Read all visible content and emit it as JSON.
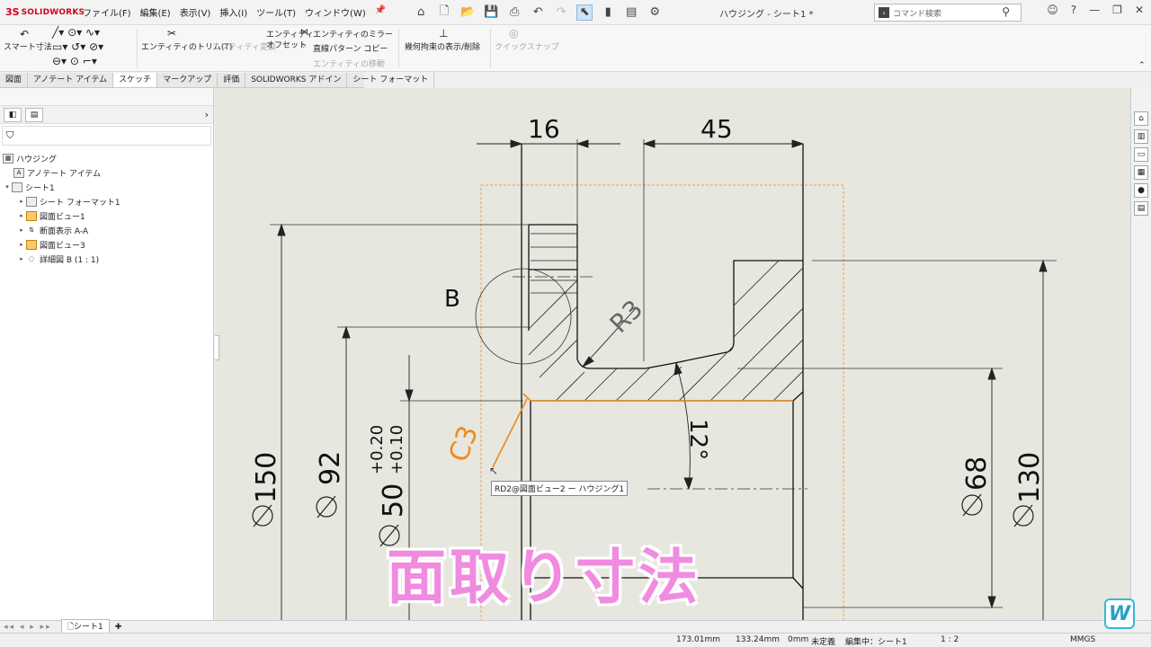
{
  "app": {
    "logo_brand": "SOLIDWORKS",
    "window_title": "ハウジング - シート1 *"
  },
  "menu": [
    "ファイル(F)",
    "編集(E)",
    "表示(V)",
    "挿入(I)",
    "ツール(T)",
    "ウィンドウ(W)"
  ],
  "search": {
    "placeholder": "コマンド検索"
  },
  "ribbon": {
    "smart_dim": "スマート寸法",
    "trim": "エンティティのトリム(T)",
    "convert": "エンティティ変換",
    "offset_line1": "エンティティ",
    "offset_line2": "オフセット",
    "mirror": "エンティティのミラー",
    "linear_pattern": "直線パターン コピー",
    "move": "エンティティの移動",
    "relations": "幾何拘束の表示/削除",
    "quick_snap": "クイックスナップ"
  },
  "tabs": [
    "図面",
    "アノテート アイテム",
    "スケッチ",
    "マークアップ",
    "評価",
    "SOLIDWORKS アドイン",
    "シート フォーマット"
  ],
  "active_tab": "スケッチ",
  "tree": {
    "root": "ハウジング",
    "annotations": "アノテート アイテム",
    "sheet": "シート1",
    "sheet_format": "シート フォーマット1",
    "view1": "図面ビュー1",
    "section": "断面表示 A-A",
    "view3": "図面ビュー3",
    "detail": "詳細図 B (1 : 1)"
  },
  "drawing": {
    "dim_16": "16",
    "dim_45": "45",
    "dim_150": "150",
    "dim_92": "92",
    "dim_50": "50",
    "tol_upper": "+0.20",
    "tol_lower": "+0.10",
    "dim_68": "68",
    "dim_130": "130",
    "radius": "R3",
    "angle": "12°",
    "detail_label": "B",
    "chamfer": "C3",
    "tooltip": "RD2@図面ビュー2 ー ハウジング1"
  },
  "sheet_tab": "シート1",
  "status": {
    "x": "173.01mm",
    "y": "133.24mm",
    "z": "0mm",
    "defined": "未定義",
    "editing": "編集中：シート1",
    "scale": "1 : 2",
    "units": "MMGS"
  },
  "overlay_caption": "面取り寸法",
  "colors": {
    "highlight": "#f08a1c",
    "caption": "#f08be0",
    "canvas": "#e7e6df"
  }
}
